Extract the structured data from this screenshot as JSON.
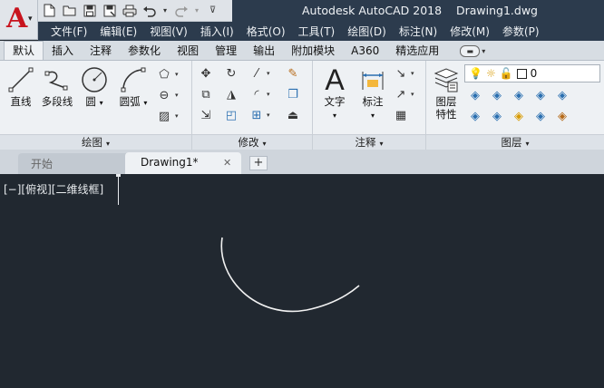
{
  "title": {
    "app_name": "Autodesk AutoCAD 2018",
    "document": "Drawing1.dwg"
  },
  "menu": [
    "文件(F)",
    "编辑(E)",
    "视图(V)",
    "插入(I)",
    "格式(O)",
    "工具(T)",
    "绘图(D)",
    "标注(N)",
    "修改(M)",
    "参数(P)"
  ],
  "ribbon_tabs": [
    {
      "label": "默认",
      "active": true
    },
    {
      "label": "插入"
    },
    {
      "label": "注释"
    },
    {
      "label": "参数化"
    },
    {
      "label": "视图"
    },
    {
      "label": "管理"
    },
    {
      "label": "输出"
    },
    {
      "label": "附加模块"
    },
    {
      "label": "A360"
    },
    {
      "label": "精选应用"
    }
  ],
  "panels": {
    "draw": {
      "title": "绘图",
      "line": "直线",
      "polyline": "多段线",
      "circle": "圆",
      "arc": "圆弧"
    },
    "modify": {
      "title": "修改"
    },
    "annotation": {
      "title": "注释",
      "text": "文字",
      "dimension": "标注"
    },
    "layers": {
      "title": "图层",
      "properties_line1": "图层",
      "properties_line2": "特性",
      "current_layer": "0"
    }
  },
  "file_tabs": {
    "start": "开始",
    "drawing": "Drawing1*",
    "add": "+"
  },
  "viewport": {
    "label": "[−][俯视][二维线框]"
  },
  "colors": {
    "titlebar": "#2c3b4d",
    "canvas": "#212830",
    "accent": "#c8141e"
  }
}
